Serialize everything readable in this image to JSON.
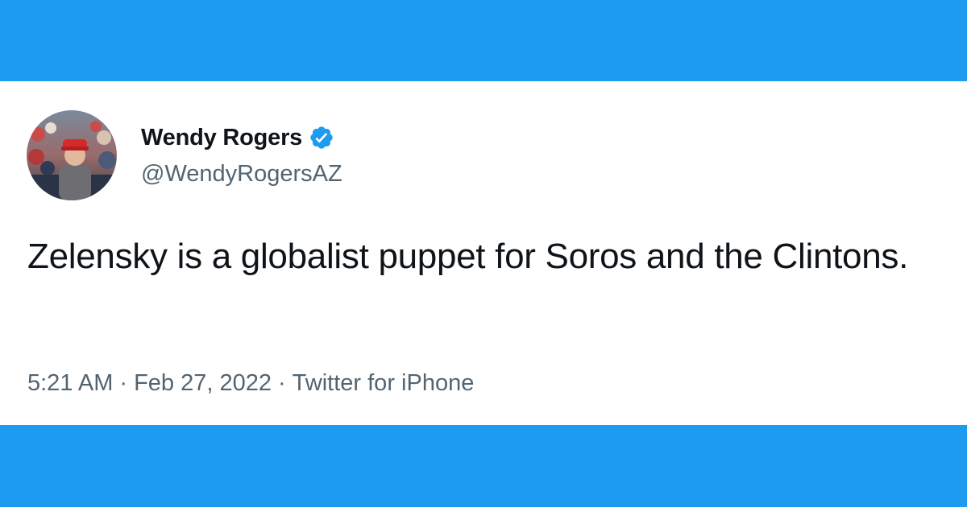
{
  "colors": {
    "brand_blue": "#1d9bf0",
    "text_primary": "#0f1419",
    "text_secondary": "#536471",
    "card_background": "#ffffff"
  },
  "author": {
    "display_name": "Wendy Rogers",
    "handle": "@WendyRogersAZ",
    "verified": true,
    "avatar_icon": "profile-photo",
    "verified_icon": "verified-badge-icon"
  },
  "tweet": {
    "text": "Zelensky is a globalist puppet for Soros and the Clintons.",
    "time": "5:21 AM",
    "separator": "·",
    "date": "Feb 27, 2022",
    "source": "Twitter for iPhone"
  }
}
